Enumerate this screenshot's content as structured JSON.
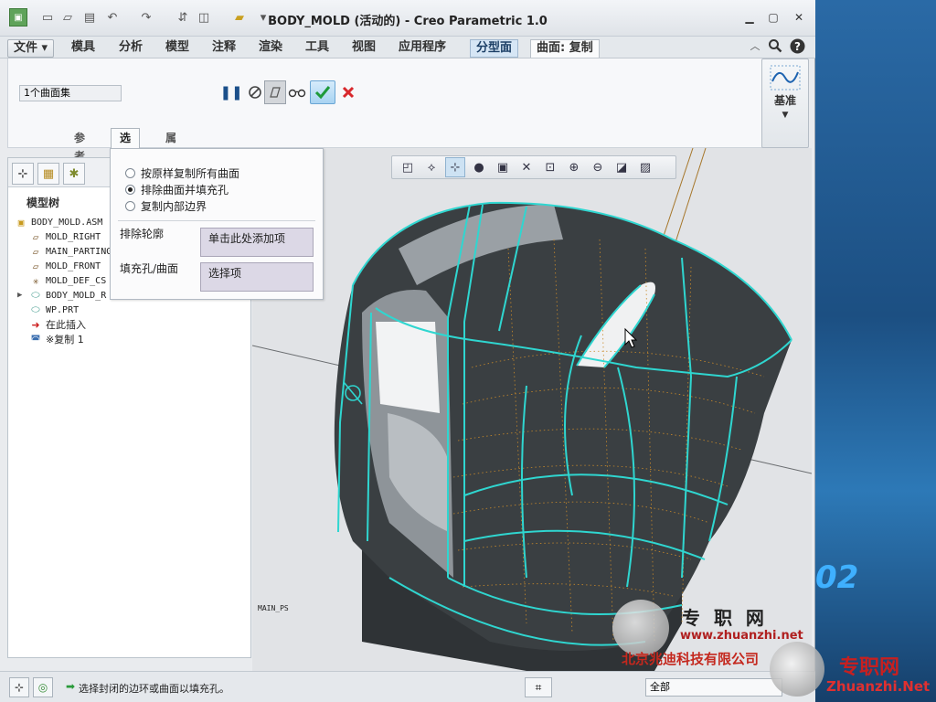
{
  "window": {
    "title": "BODY_MOLD (活动的) - Creo Parametric 1.0"
  },
  "menu": {
    "file": "文件",
    "tabs": [
      "模具",
      "分析",
      "模型",
      "注释",
      "渲染",
      "工具",
      "视图",
      "应用程序"
    ],
    "context_tab": "分型面",
    "current_tab": "曲面: 复制"
  },
  "dashboard": {
    "collector_value": "1个曲面集",
    "subtabs": [
      "参考",
      "选项",
      "属性"
    ],
    "datum_label": "基准"
  },
  "options_panel": {
    "radio_options": [
      {
        "label": "按原样复制所有曲面",
        "selected": false
      },
      {
        "label": "排除曲面并填充孔",
        "selected": true
      },
      {
        "label": "复制内部边界",
        "selected": false
      }
    ],
    "exclude_label": "排除轮廓",
    "exclude_collector": "单击此处添加项",
    "fill_label": "填充孔/曲面",
    "fill_collector": "选择项"
  },
  "model_tree": {
    "title": "模型树",
    "items": [
      {
        "label": "BODY_MOLD.ASM",
        "icon": "assembly-icon"
      },
      {
        "label": "MOLD_RIGHT",
        "icon": "datum-plane-icon"
      },
      {
        "label": "MAIN_PARTING",
        "icon": "datum-plane-icon"
      },
      {
        "label": "MOLD_FRONT",
        "icon": "datum-plane-icon"
      },
      {
        "label": "MOLD_DEF_CS",
        "icon": "coordinate-system-icon"
      },
      {
        "label": "BODY_MOLD_R",
        "icon": "part-icon"
      },
      {
        "label": "WP.PRT",
        "icon": "part-icon"
      },
      {
        "label": "在此插入",
        "icon": "insert-arrow-icon"
      },
      {
        "label": "※复制 1",
        "icon": "copy-surface-icon"
      }
    ]
  },
  "graphics": {
    "plane_tag": "MAIN_PS"
  },
  "status": {
    "message": "选择封闭的边环或曲面以填充孔。",
    "filter": "全部"
  },
  "watermark": {
    "site_cn": "专 职 网",
    "url": "www.zhuanzhi.net",
    "company": "北京兆迪科技有限公司",
    "url2": "Zhuanzhi.Net",
    "brand2": "专职网",
    "desk_num": "02"
  },
  "colors": {
    "surface_edge": "#2fd6d0",
    "model_body": "#3a3f42",
    "mesh_lines": "#c98a2a",
    "cancel": "#d8282c",
    "ok": "#1f9a3a"
  }
}
